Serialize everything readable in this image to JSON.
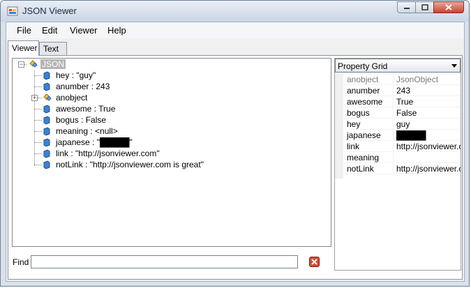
{
  "window": {
    "title": "JSON Viewer"
  },
  "menu": {
    "items": [
      "File",
      "Edit",
      "Viewer",
      "Help"
    ]
  },
  "tabs": [
    "Viewer",
    "Text"
  ],
  "tree": {
    "root": "JSON",
    "nodes": [
      {
        "text": "hey : \"guy\"",
        "icon": "value-icon"
      },
      {
        "text": "anumber : 243",
        "icon": "value-icon"
      },
      {
        "text": "anobject",
        "icon": "object-icon"
      },
      {
        "text": "awesome : True",
        "icon": "value-icon"
      },
      {
        "text": "bogus : False",
        "icon": "value-icon"
      },
      {
        "text": "meaning : <null>",
        "icon": "value-icon"
      },
      {
        "text": "japanese : \"█████\"",
        "icon": "value-icon"
      },
      {
        "text": "link : \"http://jsonviewer.com\"",
        "icon": "value-icon"
      },
      {
        "text": "notLink : \"http://jsonviewer.com is great\"",
        "icon": "value-icon"
      }
    ]
  },
  "find": {
    "label": "Find",
    "value": ""
  },
  "property_grid": {
    "title": "Property Grid",
    "rows": [
      {
        "key": "anobject",
        "value": "JsonObject",
        "disabled": true
      },
      {
        "key": "anumber",
        "value": "243"
      },
      {
        "key": "awesome",
        "value": "True"
      },
      {
        "key": "bogus",
        "value": "False"
      },
      {
        "key": "hey",
        "value": "guy"
      },
      {
        "key": "japanese",
        "value": "█████"
      },
      {
        "key": "link",
        "value": "http://jsonviewer.com"
      },
      {
        "key": "meaning",
        "value": ""
      },
      {
        "key": "notLink",
        "value": "http://jsonviewer.com is great"
      }
    ]
  }
}
